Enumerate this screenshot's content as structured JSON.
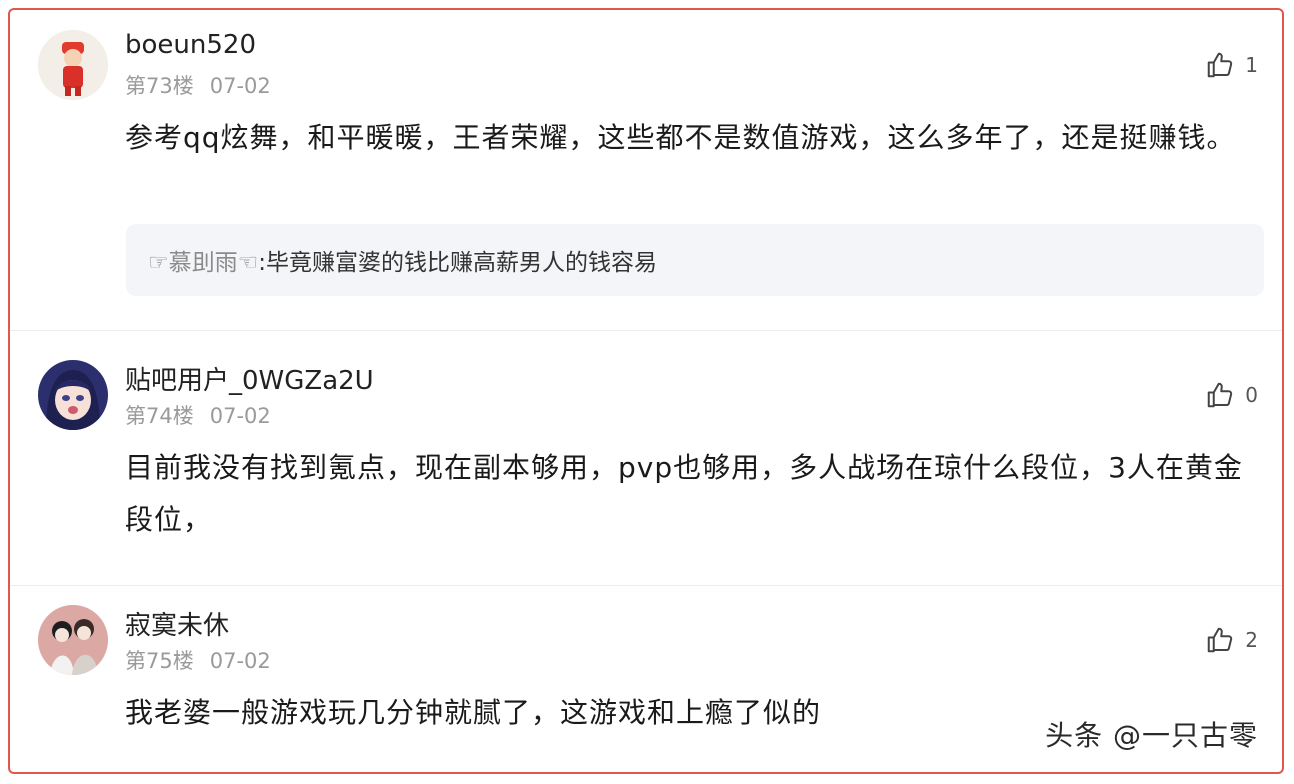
{
  "comments": [
    {
      "username": "boeun520",
      "floor": "第73楼",
      "date": "07-02",
      "likes": "1",
      "text": "参考qq炫舞，和平暖暖，王者荣耀，这些都不是数值游戏，这么多年了，还是挺赚钱。",
      "reply": {
        "user": "☞慕刞雨☜",
        "text": ":毕竟赚富婆的钱比赚高薪男人的钱容易"
      }
    },
    {
      "username": "贴吧用户_0WGZa2U",
      "floor": "第74楼",
      "date": "07-02",
      "likes": "0",
      "text": "目前我没有找到氪点，现在副本够用，pvp也够用，多人战场在琼什么段位，3人在黄金段位，"
    },
    {
      "username": "寂寞未休",
      "floor": "第75楼",
      "date": "07-02",
      "likes": "2",
      "text": "我老婆一般游戏玩几分钟就腻了，这游戏和上瘾了似的"
    }
  ],
  "watermark": "头条 @一只古零",
  "icons": {
    "like": "thumbs-up-icon"
  },
  "colors": {
    "border": "#e0574f",
    "meta": "#9a9a9a",
    "reply_bg": "#f4f5f8"
  }
}
